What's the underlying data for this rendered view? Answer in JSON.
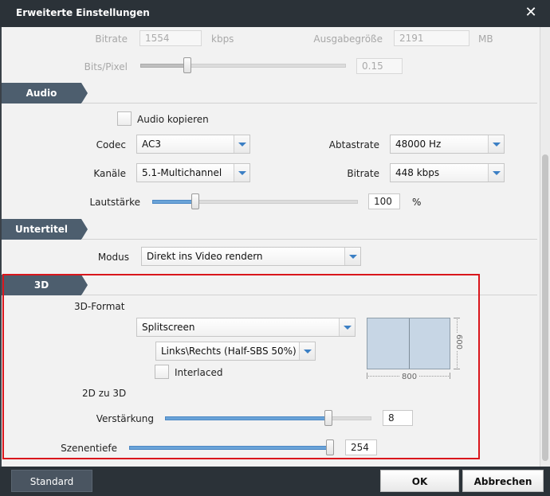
{
  "window": {
    "title": "Erweiterte Einstellungen",
    "close_glyph": "✕"
  },
  "video": {
    "bitrate_label": "Bitrate",
    "bitrate_value": "1554",
    "bitrate_unit": "kbps",
    "outsize_label": "Ausgabegröße",
    "outsize_value": "2191",
    "outsize_unit": "MB",
    "bitspixel_label": "Bits/Pixel",
    "bitspixel_value": "0.15",
    "bitspixel_level": 0.23
  },
  "audio": {
    "section_label": "Audio",
    "copy_label": "Audio kopieren",
    "copy_checked": false,
    "codec_label": "Codec",
    "codec_value": "AC3",
    "samplerate_label": "Abtastrate",
    "samplerate_value": "48000 Hz",
    "channels_label": "Kanäle",
    "channels_value": "5.1-Multichannel",
    "bitrate_label": "Bitrate",
    "bitrate_value": "448 kbps",
    "volume_label": "Lautstärke",
    "volume_value": "100",
    "volume_unit": "%",
    "volume_level": 0.21
  },
  "subtitle": {
    "section_label": "Untertitel",
    "mode_label": "Modus",
    "mode_value": "Direkt ins Video rendern"
  },
  "three_d": {
    "section_label": "3D",
    "format_label": "3D-Format",
    "format_value": "Splitscreen",
    "layout_value": "Links\\Rechts (Half-SBS 50%)",
    "interlaced_label": "Interlaced",
    "interlaced_checked": false,
    "preview_width": "800",
    "preview_height": "600",
    "conv_label": "2D zu 3D",
    "strength_label": "Verstärkung",
    "strength_value": "8",
    "strength_level": 0.79,
    "depth_label": "Szenentiefe",
    "depth_value": "254",
    "depth_level": 0.99
  },
  "buttons": {
    "standard": "Standard",
    "ok": "OK",
    "cancel": "Abbrechen"
  },
  "colors": {
    "accent": "#6aa3d8",
    "titlebar": "#2b3238",
    "highlight": "#d9161c",
    "section_tab": "#4d5e6e"
  }
}
